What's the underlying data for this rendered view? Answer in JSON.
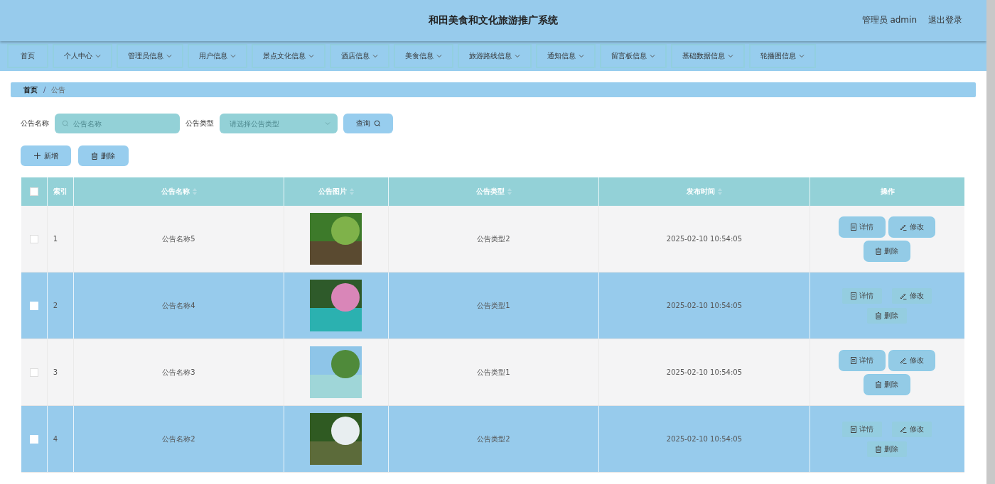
{
  "header": {
    "title": "和田美食和文化旅游推广系统",
    "user": "管理员 admin",
    "logout": "退出登录"
  },
  "nav": [
    {
      "label": "首页",
      "dropdown": false
    },
    {
      "label": "个人中心",
      "dropdown": true
    },
    {
      "label": "管理员信息",
      "dropdown": true
    },
    {
      "label": "用户信息",
      "dropdown": true
    },
    {
      "label": "景点文化信息",
      "dropdown": true
    },
    {
      "label": "酒店信息",
      "dropdown": true
    },
    {
      "label": "美食信息",
      "dropdown": true
    },
    {
      "label": "旅游路线信息",
      "dropdown": true
    },
    {
      "label": "通知信息",
      "dropdown": true
    },
    {
      "label": "留言板信息",
      "dropdown": true
    },
    {
      "label": "基础数据信息",
      "dropdown": true
    },
    {
      "label": "轮播图信息",
      "dropdown": true
    }
  ],
  "breadcrumb": {
    "items": [
      "首页",
      "公告"
    ],
    "separator": "/"
  },
  "search": {
    "fields": [
      {
        "label": "公告名称",
        "kind": "text",
        "placeholder": "公告名称"
      },
      {
        "label": "公告类型",
        "kind": "select",
        "placeholder": "请选择公告类型"
      }
    ],
    "button": "查询"
  },
  "actions": [
    {
      "label": "新增",
      "kind": "add"
    },
    {
      "label": "删除",
      "kind": "delete"
    }
  ],
  "table": {
    "select_all": {
      "checked": false
    },
    "columns": [
      {
        "label": "索引",
        "sortable": false
      },
      {
        "label": "公告名称",
        "sortable": true
      },
      {
        "label": "公告图片",
        "sortable": true
      },
      {
        "label": "公告类型",
        "sortable": true
      },
      {
        "label": "发布时间",
        "sortable": true
      },
      {
        "label": "操作",
        "sortable": false
      }
    ],
    "rows": [
      {
        "checked": false,
        "index": "1",
        "name": "公告名称5",
        "type": "公告类型2",
        "time": "2025-02-10 10:54:05",
        "buttons": [
          {
            "label": "详情",
            "kind": "detail"
          },
          {
            "label": "修改",
            "kind": "edit"
          },
          {
            "label": "删除",
            "kind": "delete"
          }
        ]
      },
      {
        "checked": false,
        "index": "2",
        "name": "公告名称4",
        "type": "公告类型1",
        "time": "2025-02-10 10:54:05",
        "buttons": [
          {
            "label": "详情",
            "kind": "detail"
          },
          {
            "label": "修改",
            "kind": "edit"
          },
          {
            "label": "删除",
            "kind": "delete"
          }
        ]
      },
      {
        "checked": false,
        "index": "3",
        "name": "公告名称3",
        "type": "公告类型1",
        "time": "2025-02-10 10:54:05",
        "buttons": [
          {
            "label": "详情",
            "kind": "detail"
          },
          {
            "label": "修改",
            "kind": "edit"
          },
          {
            "label": "删除",
            "kind": "delete"
          }
        ]
      },
      {
        "checked": false,
        "index": "4",
        "name": "公告名称2",
        "type": "公告类型2",
        "time": "2025-02-10 10:54:05",
        "buttons": [
          {
            "label": "详情",
            "kind": "detail"
          },
          {
            "label": "修改",
            "kind": "edit"
          },
          {
            "label": "删除",
            "kind": "delete"
          }
        ]
      }
    ]
  }
}
